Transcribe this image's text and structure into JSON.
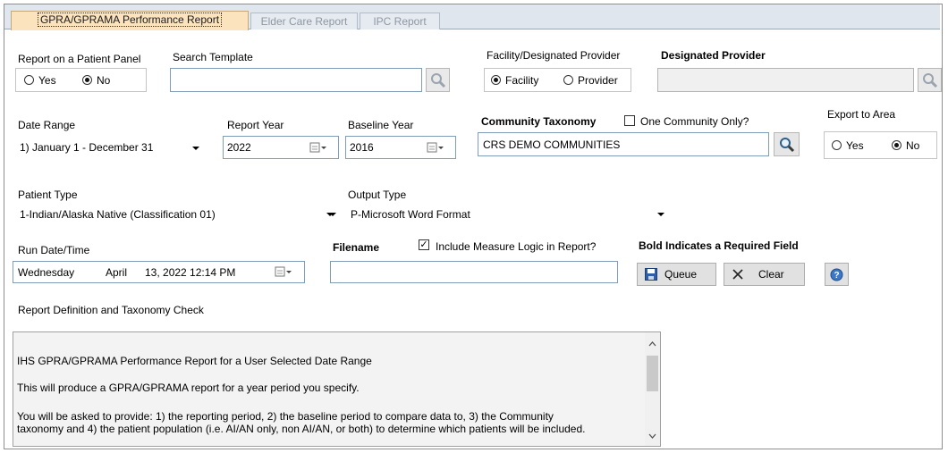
{
  "tabs": [
    {
      "label": "GPRA/GPRAMA Performance Report",
      "active": true
    },
    {
      "label": "Elder Care Report",
      "active": false
    },
    {
      "label": "IPC Report",
      "active": false
    }
  ],
  "patient_panel": {
    "label": "Report on a Patient Panel",
    "yes": "Yes",
    "no": "No",
    "selected": "No"
  },
  "search_template": {
    "label": "Search Template",
    "value": ""
  },
  "facility_provider": {
    "label": "Facility/Designated Provider",
    "facility": "Facility",
    "provider": "Provider",
    "selected": "Facility"
  },
  "designated_provider": {
    "label": "Designated Provider",
    "value": ""
  },
  "date_range": {
    "label": "Date Range",
    "value": "1) January 1 - December 31"
  },
  "report_year": {
    "label": "Report Year",
    "value": "2022"
  },
  "baseline_year": {
    "label": "Baseline Year",
    "value": "2016"
  },
  "community_taxonomy": {
    "label": "Community Taxonomy",
    "one_community_label": "One Community Only?",
    "one_community_checked": false,
    "value": "CRS DEMO COMMUNITIES"
  },
  "export_to_area": {
    "label": "Export to Area",
    "yes": "Yes",
    "no": "No",
    "selected": "No"
  },
  "patient_type": {
    "label": "Patient Type",
    "value": "1-Indian/Alaska Native (Classification 01)"
  },
  "output_type": {
    "label": "Output Type",
    "value": "P-Microsoft Word Format"
  },
  "run_datetime": {
    "label": "Run Date/Time",
    "day": "Wednesday",
    "month": "April",
    "rest": "13, 2022 12:14 PM"
  },
  "filename": {
    "label": "Filename",
    "value": ""
  },
  "include_logic": {
    "label": "Include Measure Logic in Report?",
    "checked": true
  },
  "required_note": "Bold Indicates a Required Field",
  "buttons": {
    "queue": "Queue",
    "clear": "Clear"
  },
  "definition": {
    "label": "Report Definition and Taxonomy Check",
    "lines": [
      "IHS GPRA/GPRAMA Performance Report for a User Selected Date Range",
      "This will produce a GPRA/GPRAMA report for a year period you specify.",
      "You will be asked to provide: 1) the reporting period, 2) the baseline period to compare data to, 3) the Community",
      "taxonomy and 4) the patient population (i.e. AI/AN only, non AI/AN, or both) to determine which patients will be included."
    ]
  }
}
